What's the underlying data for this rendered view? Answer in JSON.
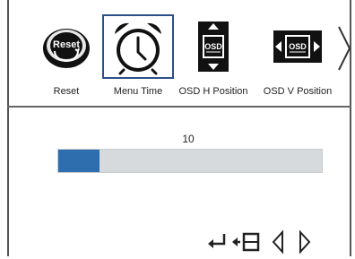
{
  "menu": {
    "items": [
      {
        "label": "Reset",
        "icon": "reset-icon",
        "selected": false
      },
      {
        "label": "Menu Time",
        "icon": "alarm-clock-icon",
        "selected": true
      },
      {
        "label": "OSD H Position",
        "icon": "osd-h-position-icon",
        "selected": false
      },
      {
        "label": "OSD V Position",
        "icon": "osd-v-position-icon",
        "selected": false
      }
    ],
    "reset_icon_text": "Reset",
    "osd_icon_text": "OSD",
    "next_icon": "chevron-right-icon"
  },
  "setting": {
    "value": "10",
    "fill_fraction": 0.155
  },
  "nav": {
    "icons": [
      "enter-icon",
      "exit-icon",
      "left-triangle-icon",
      "right-triangle-icon"
    ]
  },
  "colors": {
    "accent_border": "#2d4f88",
    "bar_fill": "#2e6eae",
    "bar_track": "#d7dadd"
  }
}
